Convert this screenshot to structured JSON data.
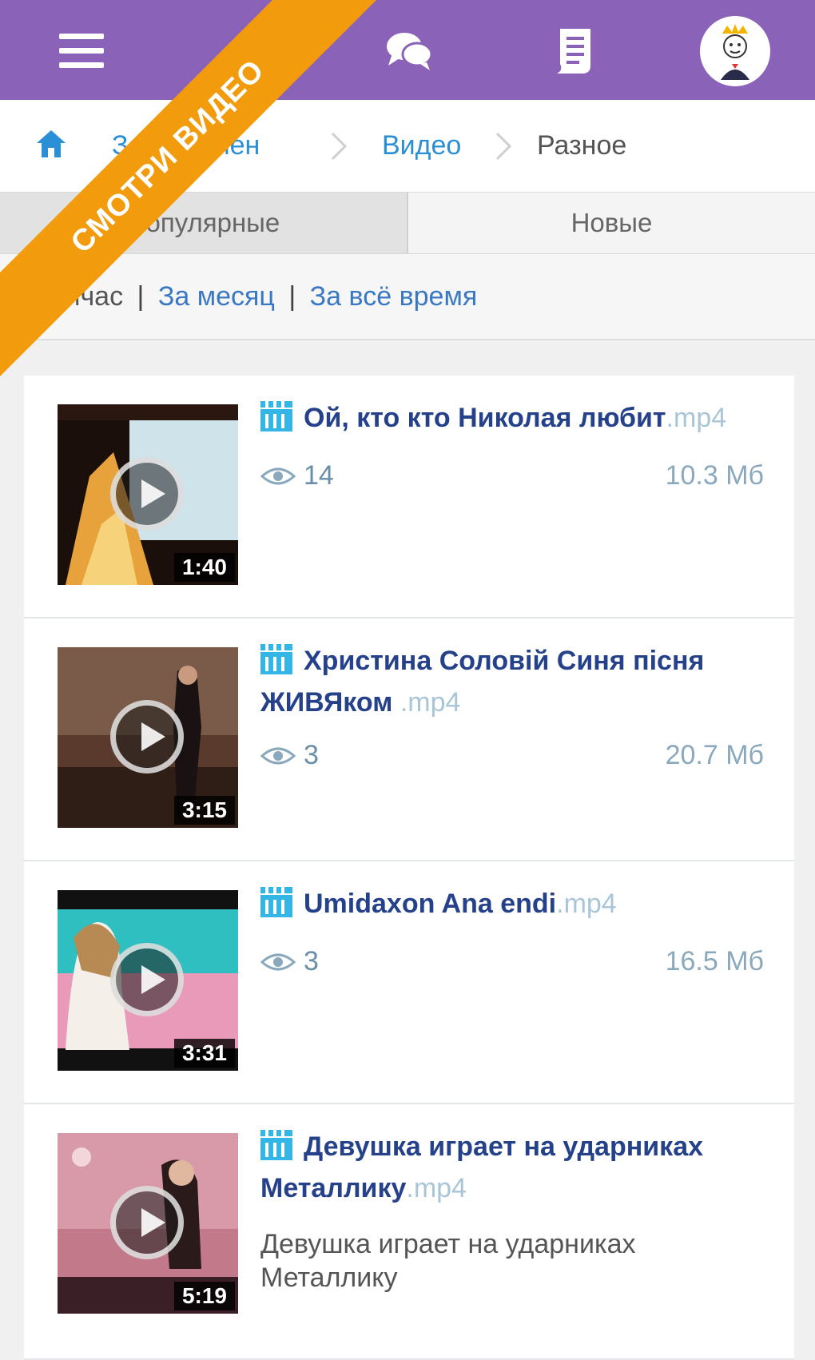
{
  "topbar": {
    "menu_icon": "hamburger-menu-icon",
    "chat_icon": "chat-bubbles-icon",
    "doc_icon": "document-icon",
    "avatar_icon": "avatar-icon",
    "color": "#8a63b8"
  },
  "breadcrumb": {
    "home_icon": "home-icon",
    "items": [
      {
        "label": "Зона обмен",
        "link": true
      },
      {
        "label": "Видео",
        "link": true
      },
      {
        "label": "Разное",
        "link": false
      }
    ]
  },
  "tabs": [
    {
      "label": "Популярные",
      "active": true
    },
    {
      "label": "Новые",
      "active": false
    }
  ],
  "period": {
    "current": "Сейчас",
    "month": "За месяц",
    "all_time": "За всё время",
    "separator": "|"
  },
  "ribbon": {
    "label": "СМОТРИ ВИДЕО",
    "color": "#f29b0c"
  },
  "videos": [
    {
      "title": "Ой, кто кто Николая любит",
      "ext": ".mp4",
      "views": "14",
      "size": "10.3 Мб",
      "duration": "1:40",
      "description": ""
    },
    {
      "title": "Христина Соловій Синя пісня ЖИВЯком ",
      "ext": ".mp4",
      "views": "3",
      "size": "20.7 Мб",
      "duration": "3:15",
      "description": ""
    },
    {
      "title": "Umidaxon Ana endi",
      "ext": ".mp4",
      "views": "3",
      "size": "16.5 Мб",
      "duration": "3:31",
      "description": ""
    },
    {
      "title": "Девушка играет на ударниках Металлику",
      "ext": ".mp4",
      "views": "",
      "size": "",
      "duration": "5:19",
      "description": "Девушка играет на ударниках Металлику"
    }
  ]
}
